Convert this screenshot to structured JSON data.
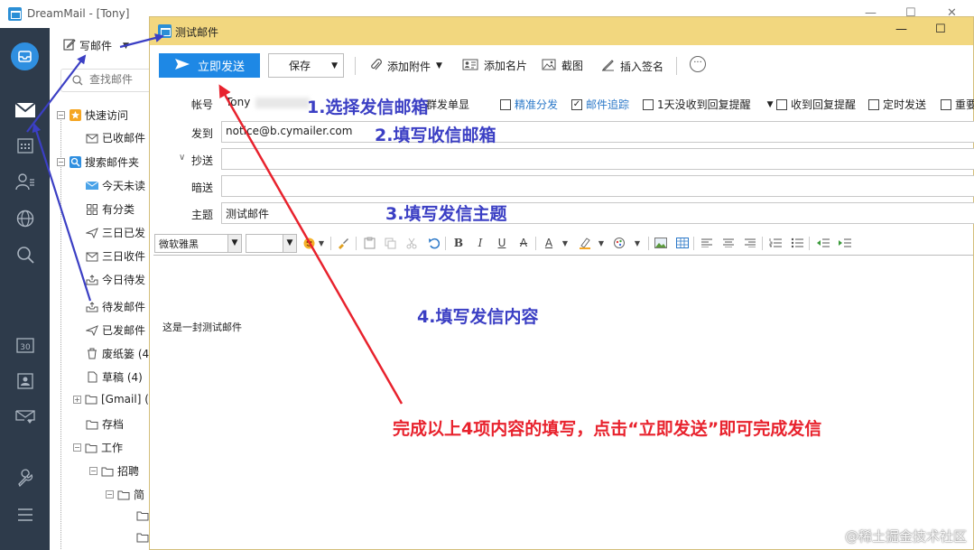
{
  "main_window": {
    "title": "DreamMail - [Tony]",
    "compose_label": "写邮件",
    "search_placeholder": "查找邮件",
    "tree": [
      {
        "label": "快速访问"
      },
      {
        "label": "已收邮件"
      },
      {
        "label": "搜索邮件夹"
      },
      {
        "label": "今天未读"
      },
      {
        "label": "有分类"
      },
      {
        "label": "三日已发"
      },
      {
        "label": "三日收件"
      },
      {
        "label": "今日待发"
      },
      {
        "label": "待发邮件"
      },
      {
        "label": "已发邮件"
      },
      {
        "label": "废纸篓 (4"
      },
      {
        "label": "草稿 (4)"
      },
      {
        "label": "[Gmail] ("
      },
      {
        "label": "存档"
      },
      {
        "label": "工作"
      },
      {
        "label": "招聘"
      },
      {
        "label": "简"
      }
    ]
  },
  "dialog": {
    "title": "测试邮件",
    "toolbar": {
      "send_label": "立即发送",
      "save_label": "保存",
      "attach_label": "添加附件",
      "card_label": "添加名片",
      "screenshot_label": "截图",
      "signature_label": "插入签名"
    },
    "fields": {
      "account_label": "帐号",
      "account_value": "Tony",
      "to_label": "发到",
      "to_value": "notice@b.cymailer.com",
      "cc_label": "抄送",
      "bcc_label": "暗送",
      "subject_label": "主题",
      "subject_value": "测试邮件"
    },
    "options": {
      "mass_single": "群发单显",
      "precise_split": "精准分发",
      "tracking": "邮件追踪",
      "reply_reminder": "1天没收到回复提醒",
      "receipt_reminder": "收到回复提醒",
      "scheduled": "定时发送",
      "important": "重要"
    },
    "format": {
      "font": "微软雅黑"
    },
    "body_text": "这是一封测试邮件"
  },
  "annotations": {
    "step1": "1.选择发信邮箱",
    "step2": "2.填写收信邮箱",
    "step3": "3.填写发信主题",
    "step4": "4.填写发信内容",
    "final": "完成以上4项内容的填写，点击“立即发送”即可完成发信",
    "watermark": "@稀土掘金技术社区"
  },
  "colors": {
    "sidebar_bg": "#2e3b4b",
    "dialog_title_bg": "#f2d77f",
    "send_button": "#1e88e5",
    "annotation_blue": "#3b3fc4",
    "annotation_red": "#e8222d"
  }
}
